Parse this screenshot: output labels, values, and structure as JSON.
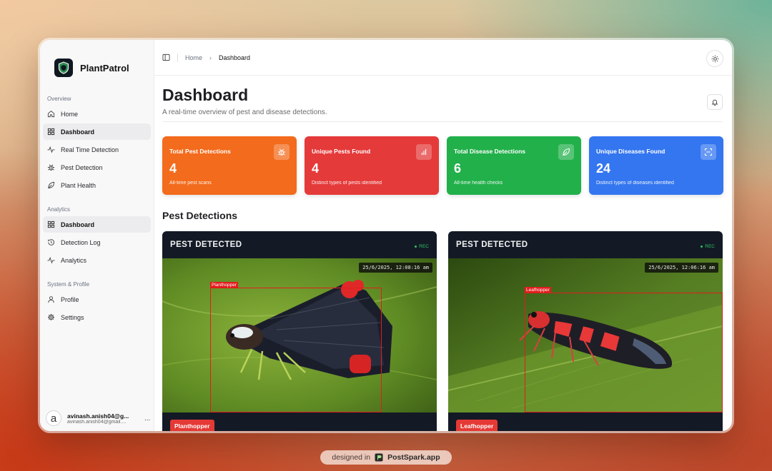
{
  "app": {
    "name": "PlantPatrol"
  },
  "sidebar": {
    "sections": [
      {
        "heading": "Overview",
        "items": [
          {
            "label": "Home",
            "icon": "home-icon"
          },
          {
            "label": "Dashboard",
            "icon": "grid-icon"
          },
          {
            "label": "Real Time Detection",
            "icon": "activity-icon"
          },
          {
            "label": "Pest Detection",
            "icon": "bug-icon"
          },
          {
            "label": "Plant Health",
            "icon": "leaf-icon"
          }
        ]
      },
      {
        "heading": "Analytics",
        "items": [
          {
            "label": "Dashboard",
            "icon": "grid-icon",
            "active": true
          },
          {
            "label": "Detection Log",
            "icon": "history-icon"
          },
          {
            "label": "Analytics",
            "icon": "activity-icon"
          }
        ]
      },
      {
        "heading": "System & Profile",
        "items": [
          {
            "label": "Profile",
            "icon": "user-icon"
          },
          {
            "label": "Settings",
            "icon": "gear-icon"
          }
        ]
      }
    ],
    "user": {
      "avatar_letter": "a",
      "name": "avinash.anish04@g...",
      "email": "avinash.anish04@gmail....",
      "more": "..."
    }
  },
  "breadcrumb": {
    "home": "Home",
    "current": "Dashboard"
  },
  "page": {
    "title": "Dashboard",
    "subtitle": "A real-time overview of pest and disease detections."
  },
  "stats": [
    {
      "title": "Total Pest Detections",
      "value": "4",
      "desc": "All-time pest scans",
      "color": "#f36b1c",
      "icon": "bug-icon"
    },
    {
      "title": "Unique Pests Found",
      "value": "4",
      "desc": "Distinct types of pests identified",
      "color": "#e53a3a",
      "icon": "bar-chart-icon"
    },
    {
      "title": "Total Disease Detections",
      "value": "6",
      "desc": "All-time health checks",
      "color": "#22b04b",
      "icon": "leaf-icon"
    },
    {
      "title": "Unique Diseases Found",
      "value": "24",
      "desc": "Distinct types of diseases identified",
      "color": "#3476f0",
      "icon": "scan-icon"
    }
  ],
  "detections_section": {
    "title": "Pest Detections"
  },
  "detections": [
    {
      "header": "PEST DETECTED",
      "rec": "REC",
      "timestamp": "25/6/2025, 12:08:16 am",
      "box_label": "Planthopper",
      "badge": "Planthopper"
    },
    {
      "header": "PEST DETECTED",
      "rec": "REC",
      "timestamp": "25/6/2025, 12:06:16 am",
      "box_label": "Leafhopper",
      "badge": "Leafhopper"
    }
  ],
  "footer": {
    "prefix": "designed in",
    "brand": "PostSpark.app"
  },
  "colors": {
    "card_dark": "#131a26",
    "detection_red": "#e11d1d",
    "rec_green": "#30c060"
  }
}
